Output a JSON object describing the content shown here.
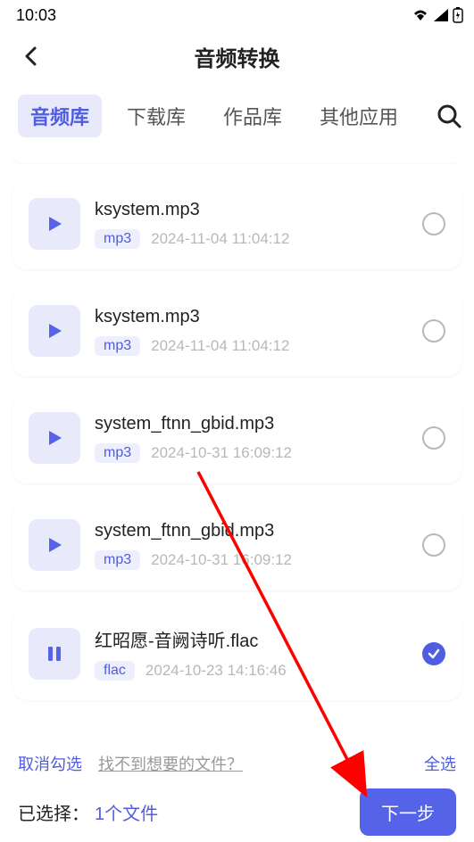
{
  "status": {
    "time": "10:03"
  },
  "header": {
    "title": "音频转换"
  },
  "tabs": {
    "items": [
      {
        "label": "音频库",
        "active": true
      },
      {
        "label": "下载库",
        "active": false
      },
      {
        "label": "作品库",
        "active": false
      },
      {
        "label": "其他应用",
        "active": false
      }
    ]
  },
  "files": [
    {
      "name": "ksystem.mp3",
      "format": "mp3",
      "date": "2024-11-04 11:04:12",
      "selected": false,
      "playing": false
    },
    {
      "name": "ksystem.mp3",
      "format": "mp3",
      "date": "2024-11-04 11:04:12",
      "selected": false,
      "playing": false
    },
    {
      "name": "system_ftnn_gbid.mp3",
      "format": "mp3",
      "date": "2024-10-31 16:09:12",
      "selected": false,
      "playing": false
    },
    {
      "name": "system_ftnn_gbid.mp3",
      "format": "mp3",
      "date": "2024-10-31 16:09:12",
      "selected": false,
      "playing": false
    },
    {
      "name": "红昭愿-音阙诗听.flac",
      "format": "flac",
      "date": "2024-10-23 14:16:46",
      "selected": true,
      "playing": true
    }
  ],
  "footer": {
    "cancel_selection": "取消勾选",
    "help_link": "找不到想要的文件？",
    "select_all": "全选"
  },
  "bottom": {
    "selected_prefix": "已选择：",
    "selected_count_text": "1个文件",
    "next": "下一步"
  },
  "colors": {
    "accent": "#4F5DE0",
    "accent_light": "#E8EAFB",
    "arrow": "#FF0000"
  }
}
